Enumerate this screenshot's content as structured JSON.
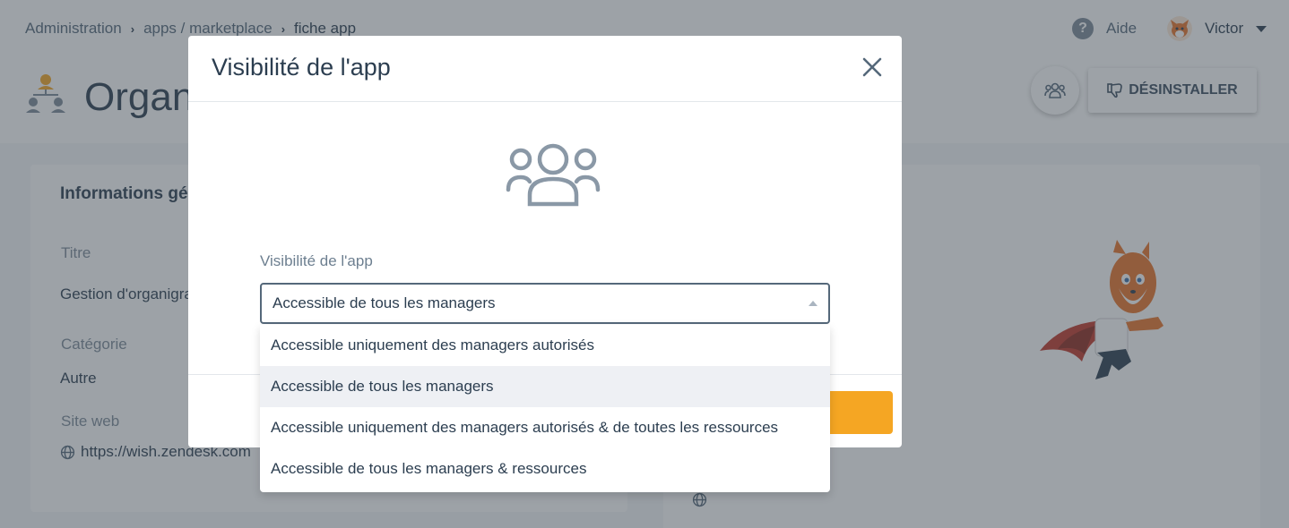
{
  "header": {
    "breadcrumb": [
      "Administration",
      "apps / marketplace",
      "fiche app"
    ],
    "help_label": "Aide",
    "user_name": "Victor"
  },
  "page": {
    "title": "Organ",
    "uninstall_label": "DÉSINSTALLER"
  },
  "info_card": {
    "title": "Informations gé",
    "fields": [
      {
        "label": "Titre",
        "value": "Gestion d'organigra"
      },
      {
        "label": "Catégorie",
        "value": "Autre"
      },
      {
        "label": "Site web",
        "value": "https://wish.zendesk.com"
      }
    ]
  },
  "modal": {
    "title": "Visibilité de l'app",
    "field_label": "Visibilité de l'app",
    "selected_value": "Accessible de tous les managers",
    "options": [
      "Accessible uniquement des managers autorisés",
      "Accessible de tous les managers",
      "Accessible uniquement des managers autorisés & de toutes les ressources",
      "Accessible de tous les managers & ressources"
    ],
    "selected_index": 1
  },
  "colors": {
    "accent": "#f5a623",
    "text": "#2c3e50",
    "muted": "#7d8b99"
  },
  "icons": [
    "chevron-right-icon",
    "help-icon",
    "chevron-down-icon",
    "org-chart-icon",
    "users-icon",
    "thumbs-down-icon",
    "close-icon",
    "globe-icon",
    "caret-up-icon"
  ]
}
